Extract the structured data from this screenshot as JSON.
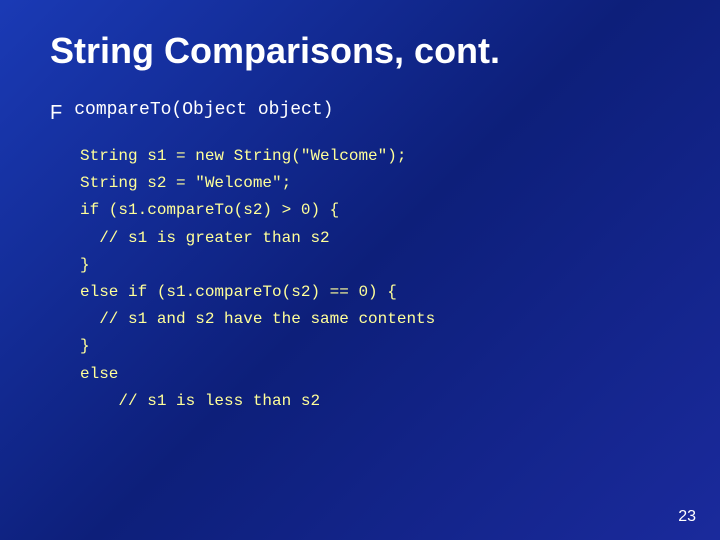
{
  "slide": {
    "title": "String Comparisons, cont.",
    "bullet": {
      "icon": "F",
      "method": "compareTo(Object object)"
    },
    "code_lines": [
      "String s1 = new String(\"Welcome\");",
      "String s2 = \"Welcome\";",
      "",
      "if (s1.compareTo(s2) > 0) {",
      "  // s1 is greater than s2",
      "}",
      "else if (s1.compareTo(s2) == 0) {",
      "  // s1 and s2 have the same contents",
      "}",
      "else",
      "    // s1 is less than s2"
    ],
    "page_number": "23"
  }
}
